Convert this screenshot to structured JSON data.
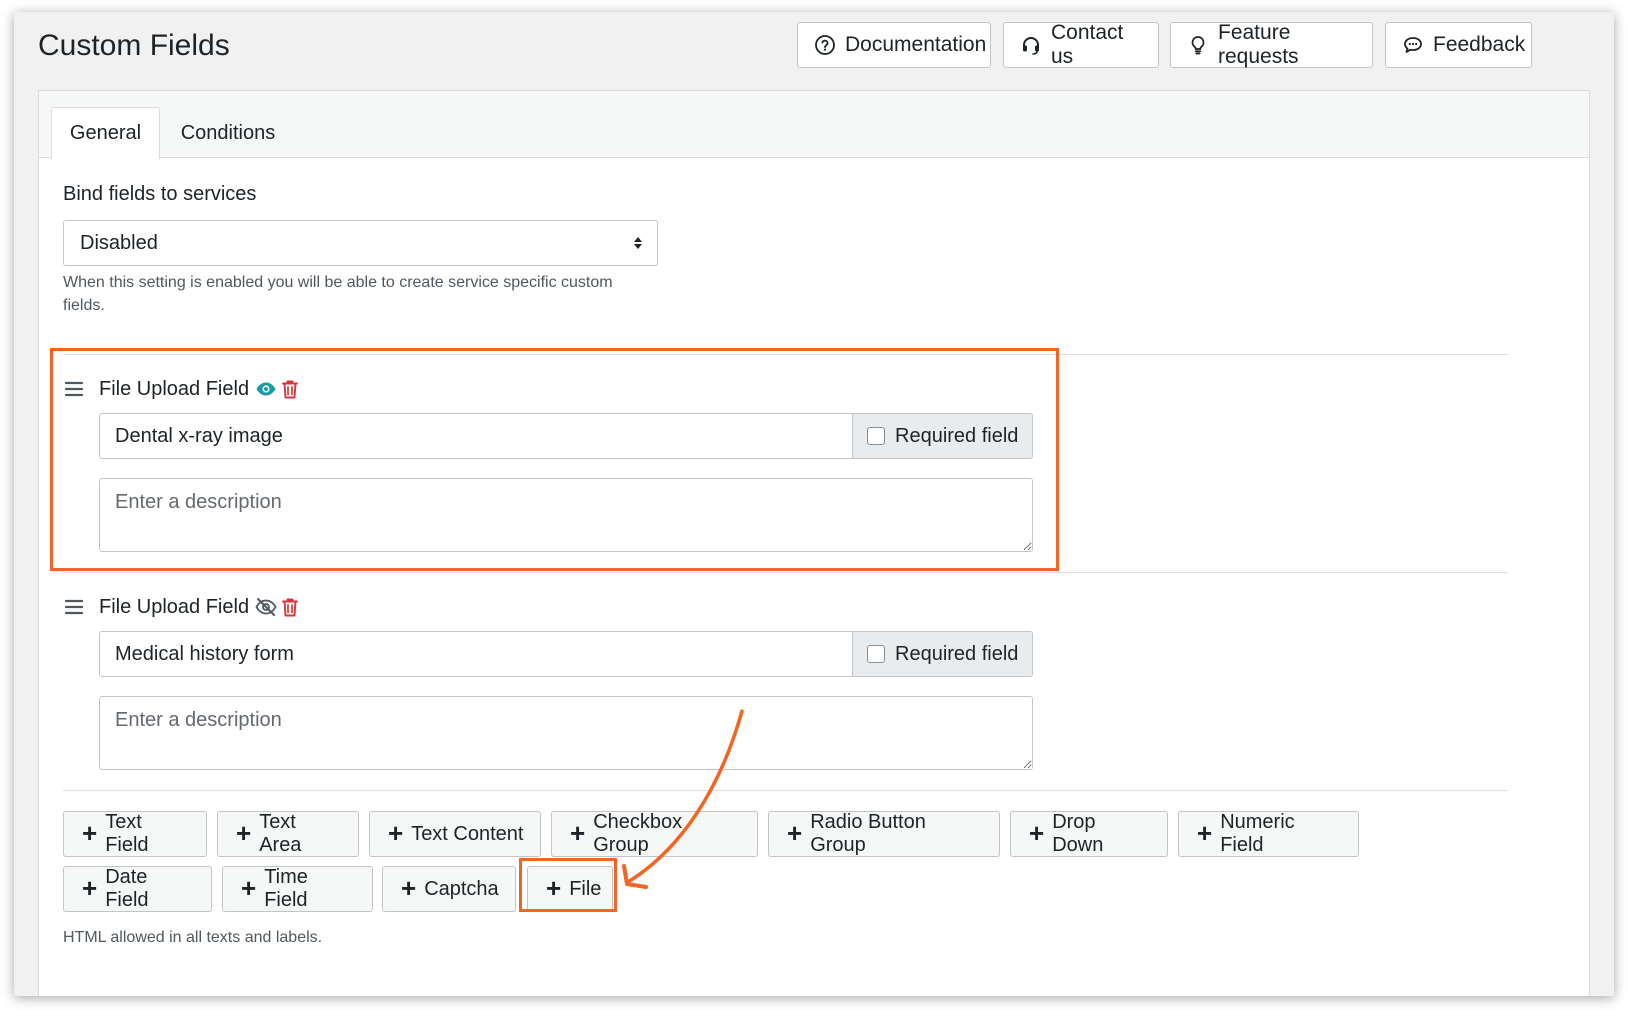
{
  "header": {
    "title": "Custom Fields",
    "buttons": {
      "documentation": "Documentation",
      "contact": "Contact us",
      "feature_requests": "Feature requests",
      "feedback": "Feedback"
    }
  },
  "tabs": {
    "general": "General",
    "conditions": "Conditions"
  },
  "bind": {
    "label": "Bind fields to services",
    "selected": "Disabled",
    "help": "When this setting is enabled you will be able to create service specific custom fields."
  },
  "fields": [
    {
      "type_label": "File Upload Field",
      "visible": true,
      "value": "Dental x-ray image",
      "required_label": "Required field",
      "required": false,
      "description_placeholder": "Enter a description"
    },
    {
      "type_label": "File Upload Field",
      "visible": false,
      "value": "Medical history form",
      "required_label": "Required field",
      "required": false,
      "description_placeholder": "Enter a description"
    }
  ],
  "add_buttons": {
    "text_field": "Text Field",
    "text_area": "Text Area",
    "text_content": "Text Content",
    "checkbox_group": "Checkbox Group",
    "radio_button_group": "Radio Button Group",
    "drop_down": "Drop Down",
    "numeric_field": "Numeric Field",
    "date_field": "Date Field",
    "time_field": "Time Field",
    "captcha": "Captcha",
    "file": "File"
  },
  "footer_note": "HTML allowed in all texts and labels.",
  "icons": {
    "visible": "eye-icon",
    "hidden": "eye-off-icon",
    "delete": "trash-icon",
    "drag": "drag-handle-icon"
  },
  "colors": {
    "highlight": "#f26522",
    "visible_icon": "#1a9aa8",
    "delete_icon": "#d63638"
  }
}
